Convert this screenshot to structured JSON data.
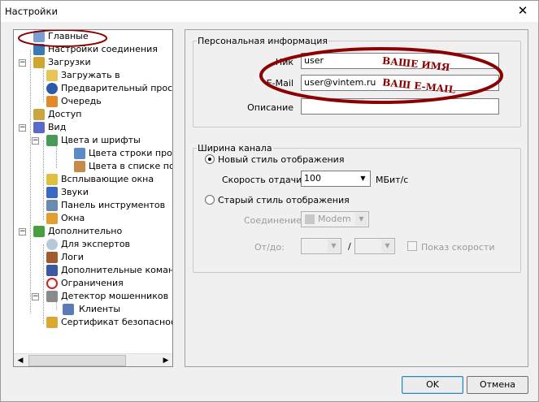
{
  "window": {
    "title": "Настройки"
  },
  "tree": [
    {
      "label": "Главные"
    },
    {
      "label": "Настройки соединения"
    },
    {
      "label": "Загрузки"
    },
    {
      "label": "Загружать в"
    },
    {
      "label": "Предварительный просмо"
    },
    {
      "label": "Очередь"
    },
    {
      "label": "Доступ"
    },
    {
      "label": "Вид"
    },
    {
      "label": "Цвета и шрифты"
    },
    {
      "label": "Цвета строки прогресс"
    },
    {
      "label": "Цвета в списке пользо"
    },
    {
      "label": "Всплывающие окна"
    },
    {
      "label": "Звуки"
    },
    {
      "label": "Панель инструментов"
    },
    {
      "label": "Окна"
    },
    {
      "label": "Дополнительно"
    },
    {
      "label": "Для экспертов"
    },
    {
      "label": "Логи"
    },
    {
      "label": "Дополнительные команд"
    },
    {
      "label": "Ограничения"
    },
    {
      "label": "Детектор мошенников"
    },
    {
      "label": "Клиенты"
    },
    {
      "label": "Сертификат безопасности"
    }
  ],
  "personal": {
    "legend": "Персональная информация",
    "nick_label": "Ник",
    "nick_value": "user",
    "email_label": "E-Mail",
    "email_value": "user@vintem.ru",
    "desc_label": "Описание",
    "desc_value": ""
  },
  "bandwidth": {
    "legend": "Ширина канала",
    "new_style": "Новый стиль отображения",
    "upload_label": "Скорость отдачи",
    "upload_value": "100",
    "upload_unit": "МБит/с",
    "old_style": "Старый стиль отображения",
    "conn_label": "Соединение",
    "conn_value": "Modem",
    "fromto_label": "От/до:",
    "separator": "/",
    "show_speed": "Показ скорости"
  },
  "annotations": {
    "name": "ВАШЕ ИМЯ",
    "email": "ВАШ E-MAIL"
  },
  "buttons": {
    "ok": "OK",
    "cancel": "Отмена"
  },
  "colors": {
    "annotation_ring": "#8b0000"
  }
}
